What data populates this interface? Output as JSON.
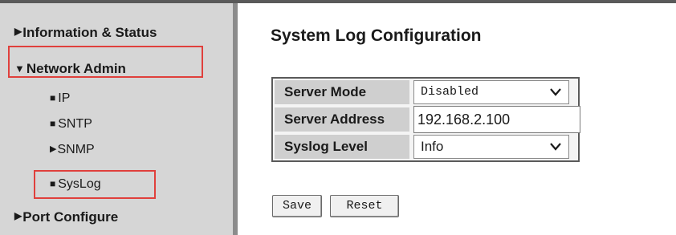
{
  "sidebar": {
    "items": [
      {
        "label": "Information & Status",
        "marker": "▶"
      },
      {
        "label": "Network Admin",
        "marker": "▼"
      },
      {
        "label": "IP",
        "marker": "■"
      },
      {
        "label": "SNTP",
        "marker": "■"
      },
      {
        "label": "SNMP",
        "marker": "▶"
      },
      {
        "label": "SysLog",
        "marker": "■"
      },
      {
        "label": "Port Configure",
        "marker": "▶"
      }
    ]
  },
  "main": {
    "title": "System Log Configuration",
    "fields": {
      "server_mode": {
        "label": "Server Mode",
        "value": "Disabled"
      },
      "server_address": {
        "label": "Server Address",
        "value": "192.168.2.100"
      },
      "syslog_level": {
        "label": "Syslog Level",
        "value": "Info"
      }
    },
    "buttons": {
      "save": "Save",
      "reset": "Reset"
    }
  },
  "colors": {
    "highlight_border": "#e0403c",
    "sidebar_background": "#d6d6d6",
    "label_cell_background": "#cfcfcf"
  }
}
